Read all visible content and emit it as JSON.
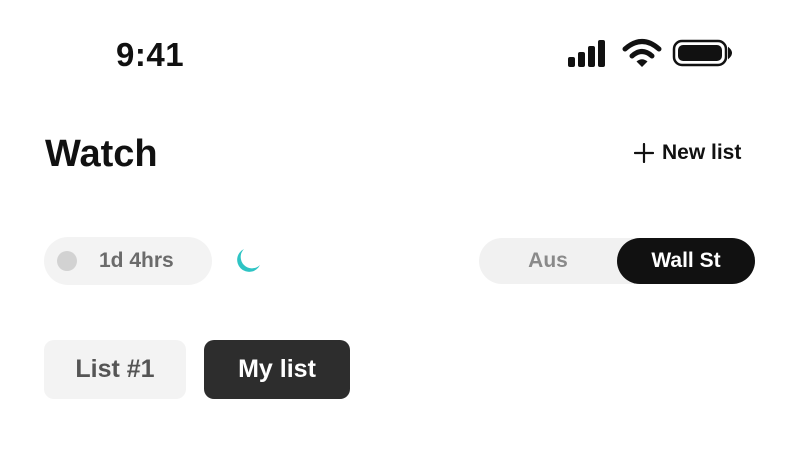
{
  "status_bar": {
    "time": "9:41",
    "icons": [
      "signal-icon",
      "wifi-icon",
      "battery-icon"
    ]
  },
  "header": {
    "title": "Watch",
    "new_list_label": "New list",
    "new_list_icon": "plus-icon"
  },
  "session": {
    "timer_label": "1d 4hrs",
    "status_icon": "moon-icon",
    "moon_color": "#2ec4c4"
  },
  "market_toggle": {
    "options": [
      {
        "label": "Aus",
        "selected": false
      },
      {
        "label": "Wall St",
        "selected": true
      }
    ]
  },
  "lists": {
    "tabs": [
      {
        "label": "List #1",
        "selected": false
      },
      {
        "label": "My list",
        "selected": true
      }
    ]
  }
}
